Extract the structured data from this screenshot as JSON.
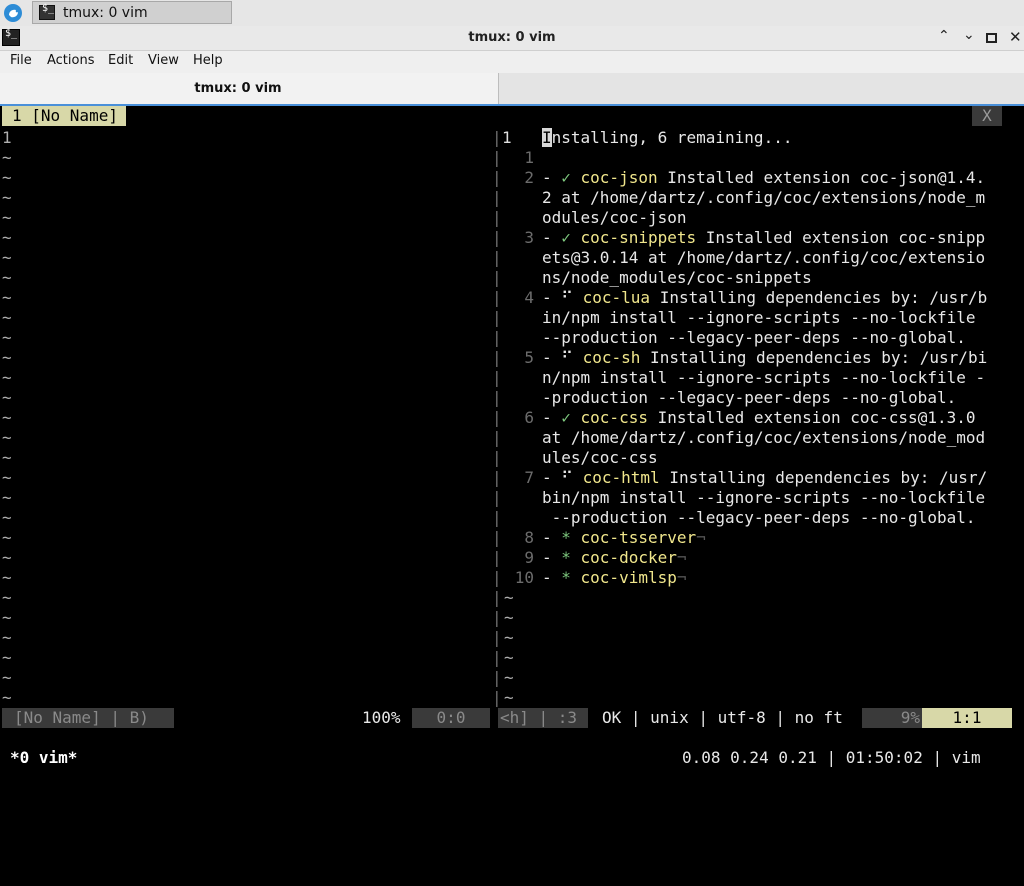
{
  "taskbar": {
    "app_label": "tmux: 0 vim"
  },
  "window": {
    "title": "tmux: 0 vim"
  },
  "menu": {
    "items": [
      "File",
      "Actions",
      "Edit",
      "View",
      "Help"
    ]
  },
  "tabs": {
    "active_label": "tmux: 0 vim"
  },
  "vim": {
    "tabline": {
      "left_tab": "1 [No Name]",
      "close": "X"
    },
    "left_pane": {
      "first_line_number": "1",
      "tilde": "~"
    },
    "right_pane": {
      "status_line": "Installing, 6 remaining...",
      "lines": [
        {
          "num": "1",
          "segments": []
        },
        {
          "num": "2",
          "segments": [
            [
              "w",
              "- "
            ],
            [
              "g",
              "✓ "
            ],
            [
              "y",
              "coc-json"
            ],
            [
              "w",
              " Installed extension coc-json@1.4."
            ]
          ]
        },
        {
          "num": "",
          "segments": [
            [
              "w",
              "2 at /home/dartz/.config/coc/extensions/node_m"
            ]
          ]
        },
        {
          "num": "",
          "segments": [
            [
              "w",
              "odules/coc-json"
            ]
          ]
        },
        {
          "num": "3",
          "segments": [
            [
              "w",
              "- "
            ],
            [
              "g",
              "✓ "
            ],
            [
              "y",
              "coc-snippets"
            ],
            [
              "w",
              " Installed extension coc-snipp"
            ]
          ]
        },
        {
          "num": "",
          "segments": [
            [
              "w",
              "ets@3.0.14 at /home/dartz/.config/coc/extensio"
            ]
          ]
        },
        {
          "num": "",
          "segments": [
            [
              "w",
              "ns/node_modules/coc-snippets"
            ]
          ]
        },
        {
          "num": "4",
          "segments": [
            [
              "w",
              "- "
            ],
            [
              "w",
              "⠋ "
            ],
            [
              "y",
              "coc-lua"
            ],
            [
              "w",
              " Installing dependencies by: /usr/b"
            ]
          ]
        },
        {
          "num": "",
          "segments": [
            [
              "w",
              "in/npm install --ignore-scripts --no-lockfile"
            ]
          ]
        },
        {
          "num": "",
          "segments": [
            [
              "w",
              "--production --legacy-peer-deps --no-global."
            ]
          ]
        },
        {
          "num": "5",
          "segments": [
            [
              "w",
              "- "
            ],
            [
              "w",
              "⠋ "
            ],
            [
              "y",
              "coc-sh"
            ],
            [
              "w",
              " Installing dependencies by: /usr/bi"
            ]
          ]
        },
        {
          "num": "",
          "segments": [
            [
              "w",
              "n/npm install --ignore-scripts --no-lockfile -"
            ]
          ]
        },
        {
          "num": "",
          "segments": [
            [
              "w",
              "-production --legacy-peer-deps --no-global."
            ]
          ]
        },
        {
          "num": "6",
          "segments": [
            [
              "w",
              "- "
            ],
            [
              "g",
              "✓ "
            ],
            [
              "y",
              "coc-css"
            ],
            [
              "w",
              " Installed extension coc-css@1.3.0"
            ]
          ]
        },
        {
          "num": "",
          "segments": [
            [
              "w",
              "at /home/dartz/.config/coc/extensions/node_mod"
            ]
          ]
        },
        {
          "num": "",
          "segments": [
            [
              "w",
              "ules/coc-css"
            ]
          ]
        },
        {
          "num": "7",
          "segments": [
            [
              "w",
              "- "
            ],
            [
              "w",
              "⠋ "
            ],
            [
              "y",
              "coc-html"
            ],
            [
              "w",
              " Installing dependencies by: /usr/"
            ]
          ]
        },
        {
          "num": "",
          "segments": [
            [
              "w",
              "bin/npm install --ignore-scripts --no-lockfile"
            ]
          ]
        },
        {
          "num": "",
          "segments": [
            [
              "w",
              " --production --legacy-peer-deps --no-global."
            ]
          ]
        },
        {
          "num": "8",
          "segments": [
            [
              "w",
              "- "
            ],
            [
              "g",
              "* "
            ],
            [
              "y",
              "coc-tsserver"
            ],
            [
              "gr",
              "¬"
            ]
          ]
        },
        {
          "num": "9",
          "segments": [
            [
              "w",
              "- "
            ],
            [
              "g",
              "* "
            ],
            [
              "y",
              "coc-docker"
            ],
            [
              "gr",
              "¬"
            ]
          ]
        },
        {
          "num": "10",
          "segments": [
            [
              "w",
              "- "
            ],
            [
              "g",
              "* "
            ],
            [
              "y",
              "coc-vimlsp"
            ],
            [
              "gr",
              "¬"
            ]
          ]
        }
      ]
    },
    "statusline": {
      "name": "[No Name] | B)",
      "percent": "100%",
      "pos_left": "0:0",
      "help": "<h] | :3",
      "info": "OK | unix | utf-8 | no ft",
      "percent2": "9%",
      "pos_right": "1:1"
    },
    "tmux": {
      "window": "*0 vim*",
      "status_right": "0.08 0.24 0.21 | 01:50:02 | vim"
    }
  },
  "colors": {
    "accent": "#4a90d9",
    "vim_yellow": "#f0e68c",
    "vim_green": "#7ec87e",
    "status_bg": "#d8d8a8"
  }
}
